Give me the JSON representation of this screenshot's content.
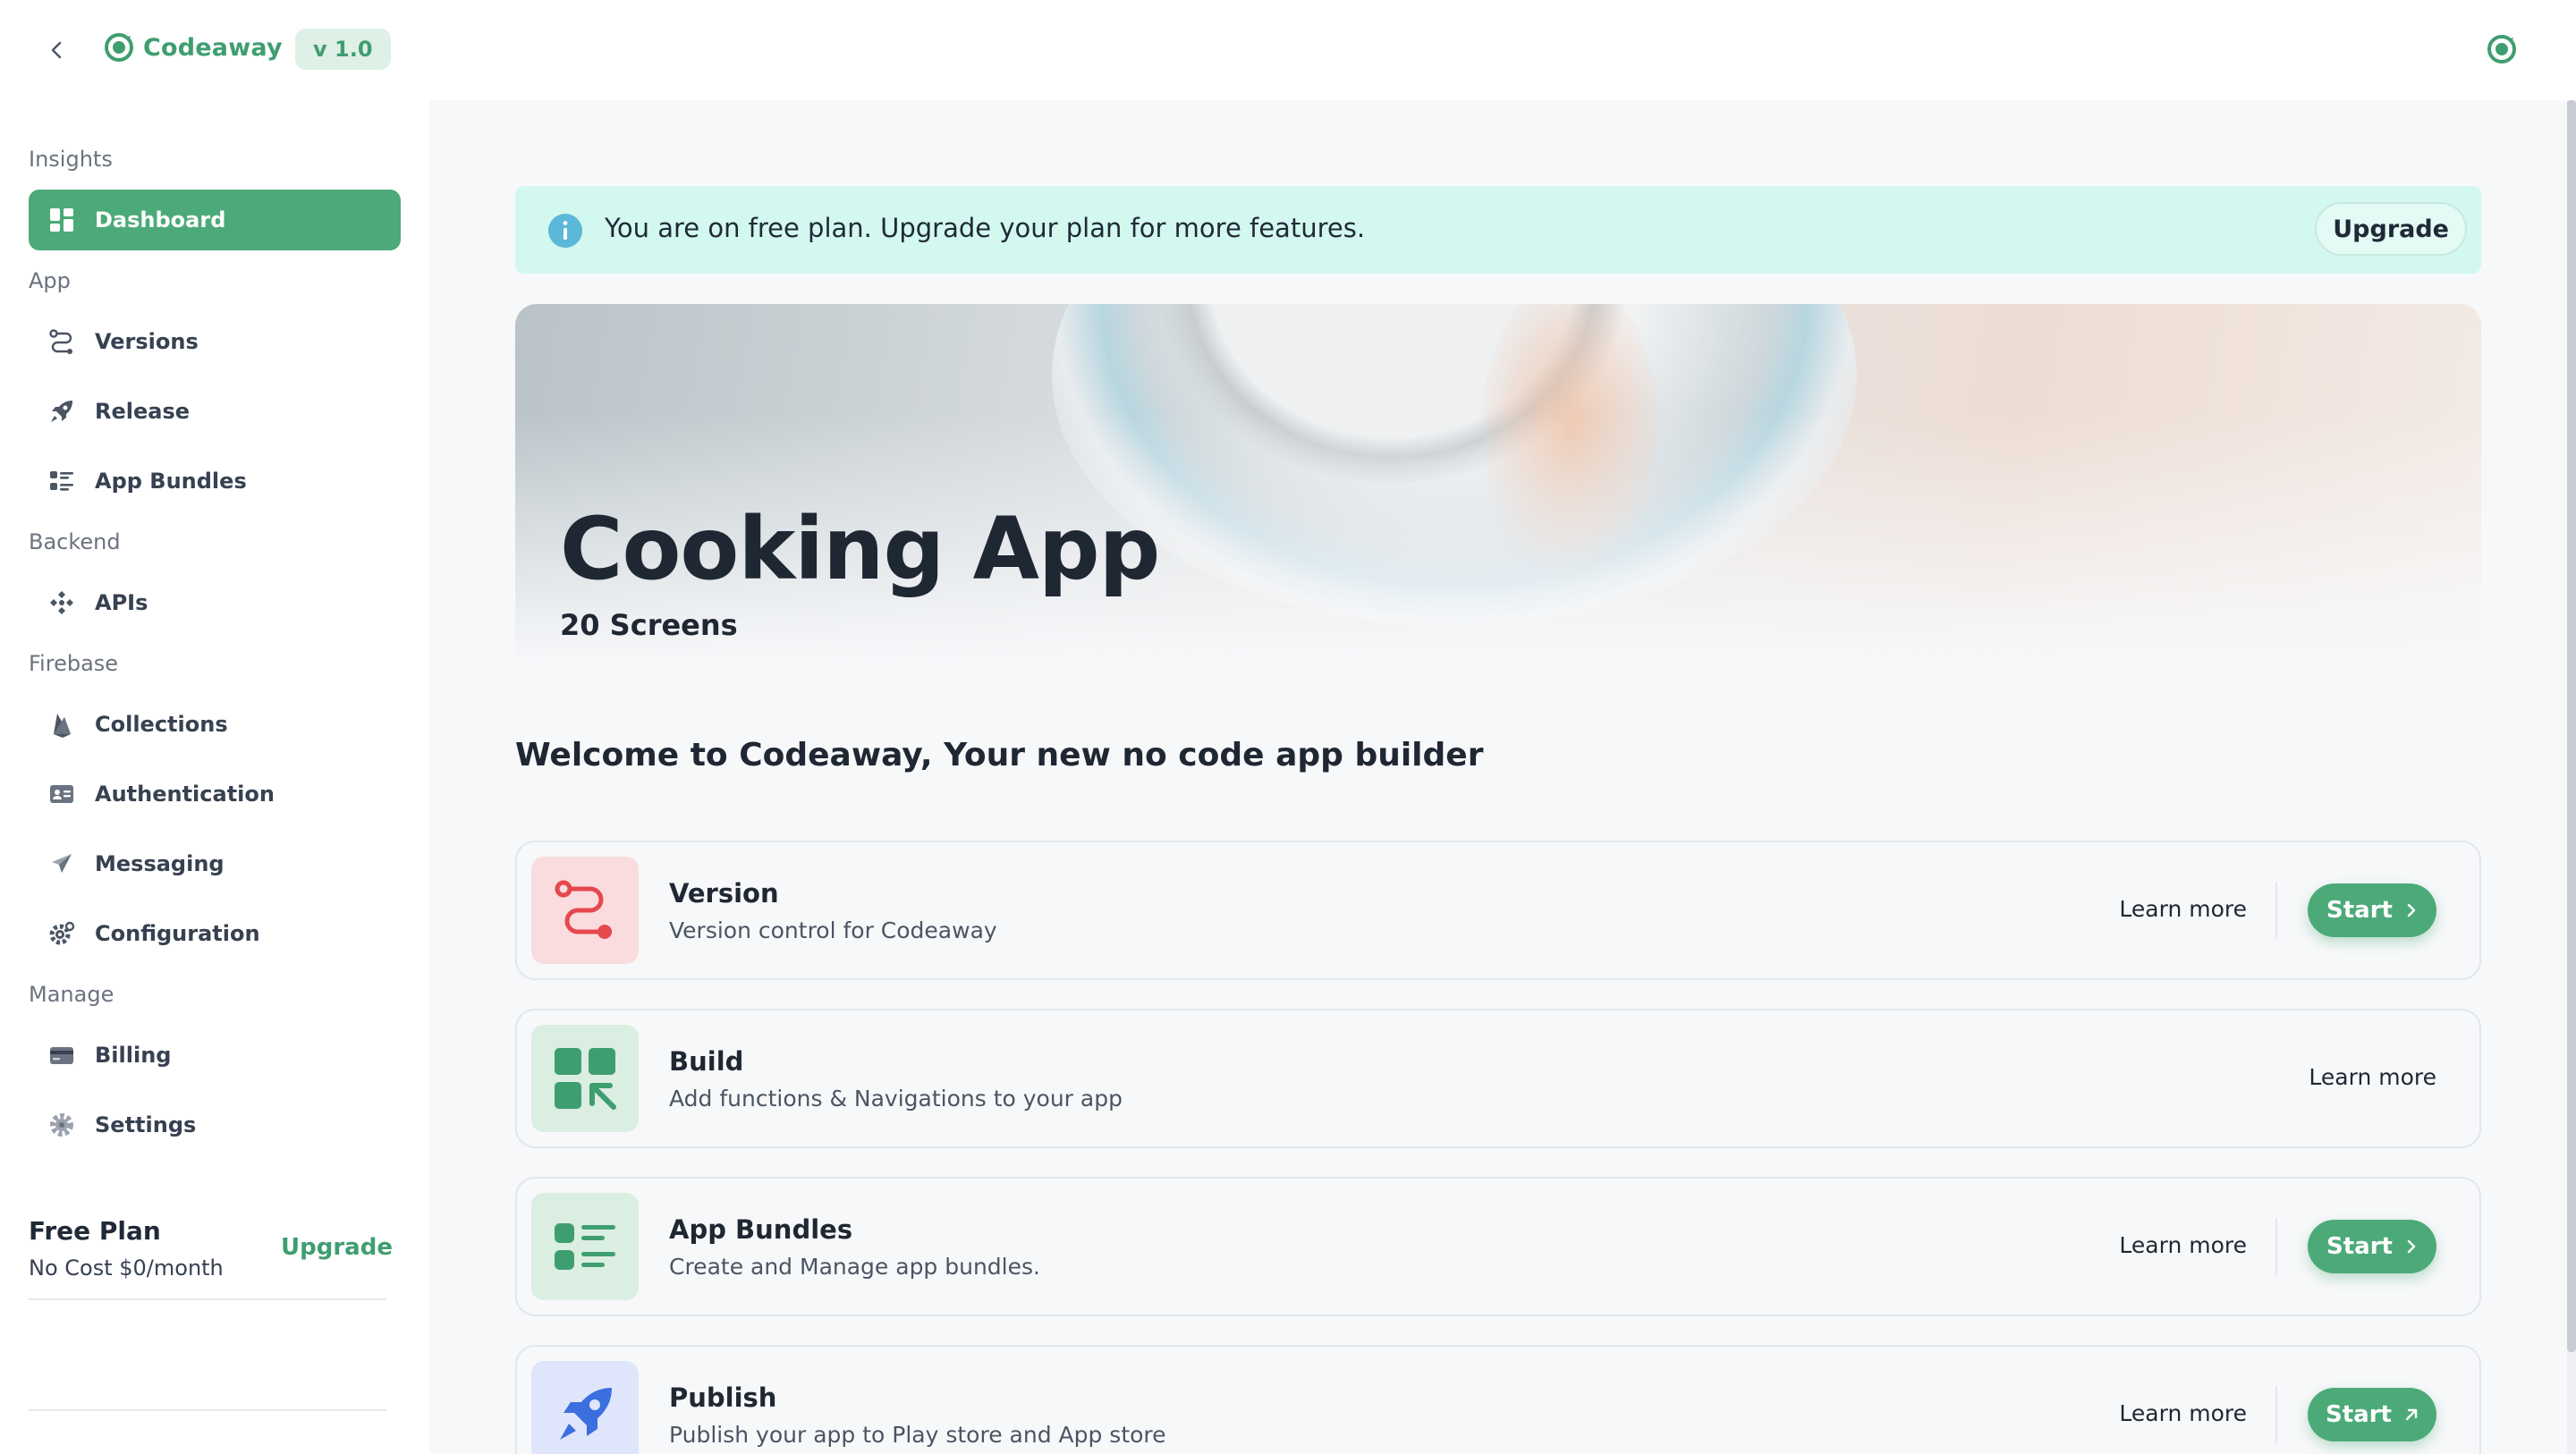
{
  "app": {
    "brand_name": "Codeaway",
    "version_label": "v 1.0",
    "brand_color": "#3f9e70"
  },
  "sidebar": {
    "sections": [
      {
        "label": "Insights"
      },
      {
        "label": "App"
      },
      {
        "label": "Backend"
      },
      {
        "label": "Firebase"
      },
      {
        "label": "Manage"
      }
    ],
    "items": [
      {
        "label": "Dashboard",
        "icon": "dashboard-icon",
        "active": true
      },
      {
        "label": "Versions",
        "icon": "versions-icon"
      },
      {
        "label": "Release",
        "icon": "rocket-icon"
      },
      {
        "label": "App Bundles",
        "icon": "list-icon"
      },
      {
        "label": "APIs",
        "icon": "api-icon"
      },
      {
        "label": "Collections",
        "icon": "firebase-icon"
      },
      {
        "label": "Authentication",
        "icon": "id-card-icon"
      },
      {
        "label": "Messaging",
        "icon": "send-icon"
      },
      {
        "label": "Configuration",
        "icon": "gear-icon"
      },
      {
        "label": "Billing",
        "icon": "credit-card-icon"
      },
      {
        "label": "Settings",
        "icon": "settings-icon"
      }
    ],
    "plan": {
      "title": "Free Plan",
      "subtitle": "No Cost $0/month",
      "upgrade_label": "Upgrade"
    }
  },
  "banner": {
    "text": "You are on free plan. Upgrade your plan for more features.",
    "button_label": "Upgrade",
    "icon": "info-icon"
  },
  "hero": {
    "title": "Cooking App",
    "subtitle": "20 Screens"
  },
  "welcome": "Welcome to Codeaway, Your new no code app builder",
  "cards": [
    {
      "title": "Version",
      "description": "Version control for Codeaway",
      "learn_more": "Learn more",
      "start": "Start",
      "icon": "version-route-icon",
      "start_icon": "chevron-right-icon"
    },
    {
      "title": "Build",
      "description": "Add functions & Navigations to your app",
      "learn_more": "Learn more",
      "icon": "build-grid-icon"
    },
    {
      "title": "App Bundles",
      "description": "Create and Manage app bundles.",
      "learn_more": "Learn more",
      "start": "Start",
      "icon": "bundle-list-icon",
      "start_icon": "chevron-right-icon"
    },
    {
      "title": "Publish",
      "description": "Publish your app to Play store and App store",
      "learn_more": "Learn more",
      "start": "Start",
      "icon": "rocket-icon",
      "start_icon": "arrow-up-right-icon"
    }
  ]
}
